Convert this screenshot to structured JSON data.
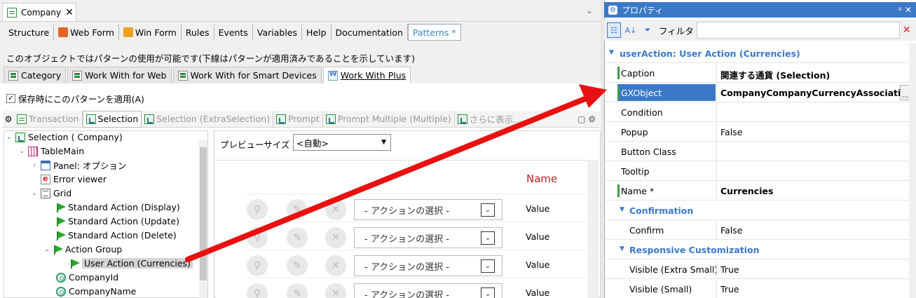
{
  "document_tab": {
    "title": "Company",
    "close": "✕"
  },
  "editor_tabs": [
    {
      "label": "Structure",
      "icon": ""
    },
    {
      "label": "Web Form",
      "icon": "web-form-icon"
    },
    {
      "label": "Win Form",
      "icon": "win-form-icon"
    },
    {
      "label": "Rules",
      "icon": ""
    },
    {
      "label": "Events",
      "icon": ""
    },
    {
      "label": "Variables",
      "icon": ""
    },
    {
      "label": "Help",
      "icon": ""
    },
    {
      "label": "Documentation",
      "icon": ""
    },
    {
      "label": "Patterns *",
      "icon": ""
    }
  ],
  "patterns_info": "このオブジェクトではパターンの使用が可能です(下線はパターンが適用済みであることを示しています)",
  "pattern_tabs": [
    {
      "label": "Category"
    },
    {
      "label": "Work With for Web"
    },
    {
      "label": "Work With for Smart Devices"
    },
    {
      "label": "Work With Plus"
    }
  ],
  "apply_on_save": {
    "label": "保存時にこのパターンを適用(A)",
    "checked": true
  },
  "instance_tabs": [
    {
      "label": "Transaction"
    },
    {
      "label": "Selection"
    },
    {
      "label": "Selection (ExtraSelection)"
    },
    {
      "label": "Prompt"
    },
    {
      "label": "Prompt Multiple (Multiple)"
    },
    {
      "label": "さらに表示..."
    }
  ],
  "tree": [
    {
      "label": "Selection ( Company)",
      "exp": "⌄",
      "icon": "selection-icon"
    },
    {
      "label": "TableMain",
      "exp": "⌄",
      "icon": "table-icon"
    },
    {
      "label": "Panel: オプション",
      "exp": "›",
      "icon": "panel-icon"
    },
    {
      "label": "Error viewer",
      "exp": "",
      "icon": "error-viewer-icon"
    },
    {
      "label": "Grid",
      "exp": "⌄",
      "icon": "grid-icon"
    },
    {
      "label": "Standard Action (Display)",
      "exp": "",
      "icon": "flag-icon"
    },
    {
      "label": "Standard Action (Update)",
      "exp": "",
      "icon": "flag-icon"
    },
    {
      "label": "Standard Action (Delete)",
      "exp": "",
      "icon": "flag-icon"
    },
    {
      "label": "Action Group",
      "exp": "⌄",
      "icon": "flag-icon"
    },
    {
      "label": "User Action (Currencies)",
      "exp": "",
      "icon": "flag-icon",
      "selected": true
    },
    {
      "label": "CompanyId",
      "exp": "",
      "icon": "attribute-icon"
    },
    {
      "label": "CompanyName",
      "exp": "",
      "icon": "attribute-icon"
    }
  ],
  "preview": {
    "size_label": "プレビューサイズ",
    "size_value": "<自動>",
    "column_header": "Name",
    "rows": [
      {
        "action": "- アクションの選択 -",
        "value": "Value"
      },
      {
        "action": "- アクションの選択 -",
        "value": "Value"
      },
      {
        "action": "- アクションの選択 -",
        "value": "Value"
      },
      {
        "action": "- アクションの選択 -",
        "value": "Value"
      }
    ]
  },
  "properties": {
    "title": "プロパティ",
    "pin": "ᵖ ✕",
    "filter_label": "フィルタ",
    "filter_value": "",
    "section_main": "userAction: User Action (Currencies)",
    "rows": [
      {
        "key": "Caption",
        "value": "関連する通貨 (Selection)",
        "bold": true,
        "mark": true
      },
      {
        "key": "GXObject",
        "value": "CompanyCompanyCurrencyAssociation",
        "bold": true,
        "mark": true,
        "selected": true
      },
      {
        "key": "Condition",
        "value": ""
      },
      {
        "key": "Popup",
        "value": "False"
      },
      {
        "key": "Button Class",
        "value": ""
      },
      {
        "key": "Tooltip",
        "value": ""
      },
      {
        "key": "Name *",
        "value": "Currencies",
        "bold": true,
        "mark": true
      }
    ],
    "section_confirmation": "Confirmation",
    "confirm_rows": [
      {
        "key": "Confirm",
        "value": "False"
      }
    ],
    "section_responsive": "Responsive Customization",
    "responsive_rows": [
      {
        "key": "Visible (Extra Small)",
        "value": "True"
      },
      {
        "key": "Visible (Small)",
        "value": "True"
      }
    ]
  },
  "colors": {
    "accent": "#3c78c8",
    "arrow": "#e81010",
    "header_red": "#b22222"
  }
}
